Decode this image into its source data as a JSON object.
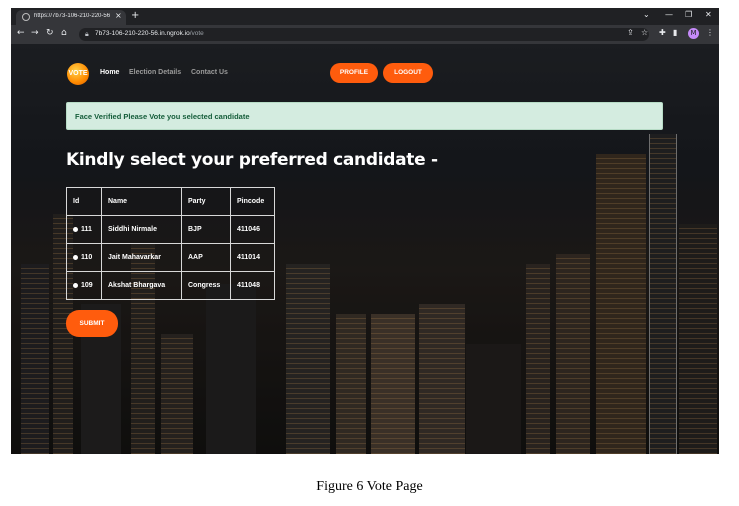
{
  "browser": {
    "tab_title": "https://7b73-106-210-220-56.in...",
    "new_tab": "+",
    "close_tab": "×",
    "url_host": "7b73-106-210-220-56.in.ngrok.io",
    "url_path": "/vote",
    "avatar_letter": "M",
    "icons": [
      "back-icon",
      "forward-icon",
      "reload-icon",
      "home-icon",
      "lock-icon",
      "share-icon",
      "star-icon",
      "extensions-icon",
      "sidepanel-icon",
      "menu-icon"
    ]
  },
  "site": {
    "logo_text": "VOTE",
    "nav": [
      {
        "label": "Home",
        "color": "#ffffff"
      },
      {
        "label": "Election Details",
        "color": "#9a9a9a"
      },
      {
        "label": "Contact Us",
        "color": "#9a9a9a"
      }
    ],
    "profile_label": "PROFILE",
    "logout_label": "LOGOUT",
    "accent": "#ff5c0d"
  },
  "alert": {
    "text": "Face Verified Please Vote you selected candidate",
    "color": "#155d3a",
    "background": "#d4ece0"
  },
  "heading": "Kindly select your preferred candidate -",
  "table": {
    "headers": [
      "Id",
      "Name",
      "Party",
      "Pincode"
    ],
    "rows": [
      {
        "id": "111",
        "name": "Siddhi Nirmale",
        "party": "BJP",
        "pincode": "411046"
      },
      {
        "id": "110",
        "name": "Jait Mahavarkar",
        "party": "AAP",
        "pincode": "411014"
      },
      {
        "id": "109",
        "name": "Akshat Bhargava",
        "party": "Congress",
        "pincode": "411048"
      }
    ]
  },
  "submit_label": "SUBMIT",
  "caption": "Figure 6 Vote Page"
}
